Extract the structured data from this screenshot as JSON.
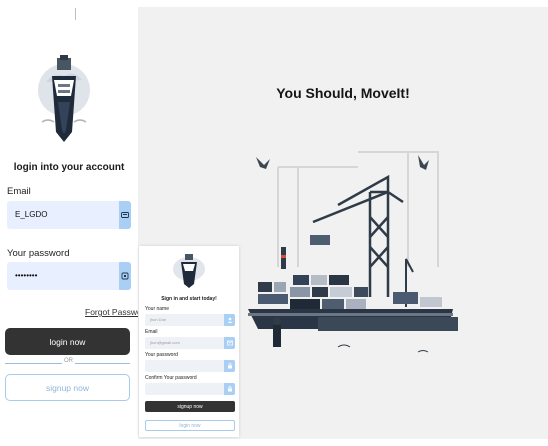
{
  "login": {
    "title": "login into your account",
    "email_label": "Email",
    "email_value": "E_LGDO",
    "password_label": "Your password",
    "password_value": "••••••••",
    "forgot_label": "Forgot Password?",
    "login_button": "login now",
    "or_text": "OR",
    "signup_button": "signup now"
  },
  "hero": {
    "headline": "You Should, MoveIt!"
  },
  "signup": {
    "title": "Sign in and start today!",
    "name_label": "Your name",
    "name_placeholder": "jhon Doe",
    "email_label": "Email",
    "email_placeholder": "jhon@gmail.com",
    "password_label": "Your password",
    "confirm_label": "Confirm Your password",
    "signup_button": "signup now",
    "login_button": "login now"
  },
  "icons": {
    "email_field": "id-card-icon",
    "password_field": "key-icon",
    "name_field": "user-icon",
    "signup_email_field": "mail-icon",
    "signup_password_field": "lock-icon"
  },
  "colors": {
    "field_bg": "#e8f0ff",
    "field_icon_bg": "#a9d0f4",
    "dark_button": "#333333",
    "outline_accent": "#a9cbe9",
    "hero_bg": "#f1f1f1"
  }
}
